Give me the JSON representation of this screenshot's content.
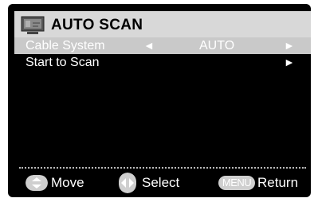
{
  "title": "AUTO SCAN",
  "menu_items": [
    {
      "label": "Cable System",
      "value": "AUTO",
      "left_arrow": "◄",
      "right_arrow": "►",
      "selected": true
    },
    {
      "label": "Start to Scan",
      "value": "",
      "left_arrow": "",
      "right_arrow": "►",
      "selected": false
    }
  ],
  "footer": {
    "move_label": "Move",
    "select_label": "Select",
    "menu_key_label": "MENU",
    "return_label": "Return"
  },
  "colors": {
    "background": "#000000",
    "titlebar": "#d8d8d8",
    "highlight": "#c9c9c9",
    "text": "#ffffff",
    "key_pill": "#cfcfcf"
  },
  "icons": {
    "title": "tv-icon",
    "move": "up-down-key-icon",
    "select": "left-right-key-icon"
  }
}
